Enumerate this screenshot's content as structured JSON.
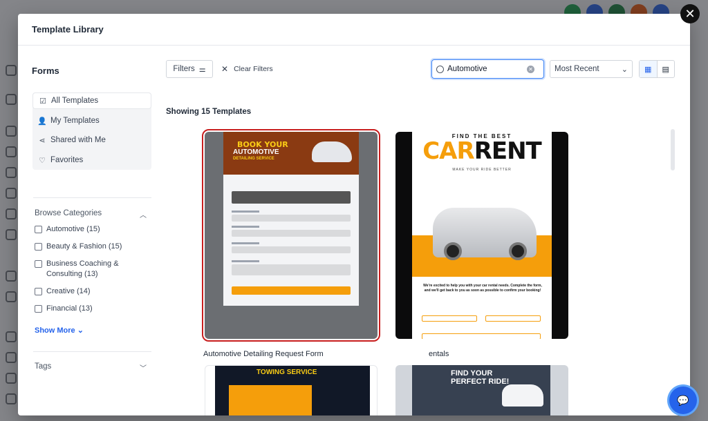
{
  "modal": {
    "title": "Template Library"
  },
  "close_icon": "close-icon",
  "sidebar": {
    "title": "Forms",
    "quick_filters": [
      {
        "label": "All Templates",
        "icon": "checkbox-icon",
        "active": true
      },
      {
        "label": "My Templates",
        "icon": "user-icon",
        "active": false
      },
      {
        "label": "Shared with Me",
        "icon": "share-icon",
        "active": false
      },
      {
        "label": "Favorites",
        "icon": "heart-icon",
        "active": false
      }
    ],
    "browse_title": "Browse Categories",
    "categories": [
      {
        "label": "Automotive (15)"
      },
      {
        "label": "Beauty & Fashion (15)"
      },
      {
        "label": "Business Coaching & Consulting (13)"
      },
      {
        "label": "Creative (14)"
      },
      {
        "label": "Financial (13)"
      }
    ],
    "show_more": "Show More",
    "tags_title": "Tags"
  },
  "toolbar": {
    "filters_label": "Filters",
    "clear_filters_label": "Clear Filters",
    "search_value": "Automotive",
    "sort_value": "Most Recent"
  },
  "results": {
    "showing": "Showing 15 Templates"
  },
  "templates": [
    {
      "title": "Automotive Detailing Request Form",
      "thumb_heading": "BOOK YOUR",
      "thumb_heading2": "AUTOMOTIVE",
      "thumb_heading3": "DETAILING SERVICE"
    },
    {
      "title": "entals",
      "thumb_top": "FIND THE BEST",
      "thumb_car": "CAR",
      "thumb_rent": "RENT",
      "thumb_sub": "MAKE YOUR RIDE BETTER",
      "thumb_blurb": "We're excited to help you with your car rental needs. Complete the form, and we'll get back to you as soon as possible to confirm your booking!"
    },
    {
      "thumb_heading": "TOWING SERVICE"
    },
    {
      "thumb_heading": "FIND YOUR PERFECT RIDE!"
    }
  ],
  "colors": {
    "accent": "#2563eb",
    "selected_outline": "#c81e1e",
    "brand_orange": "#f59e0b"
  }
}
